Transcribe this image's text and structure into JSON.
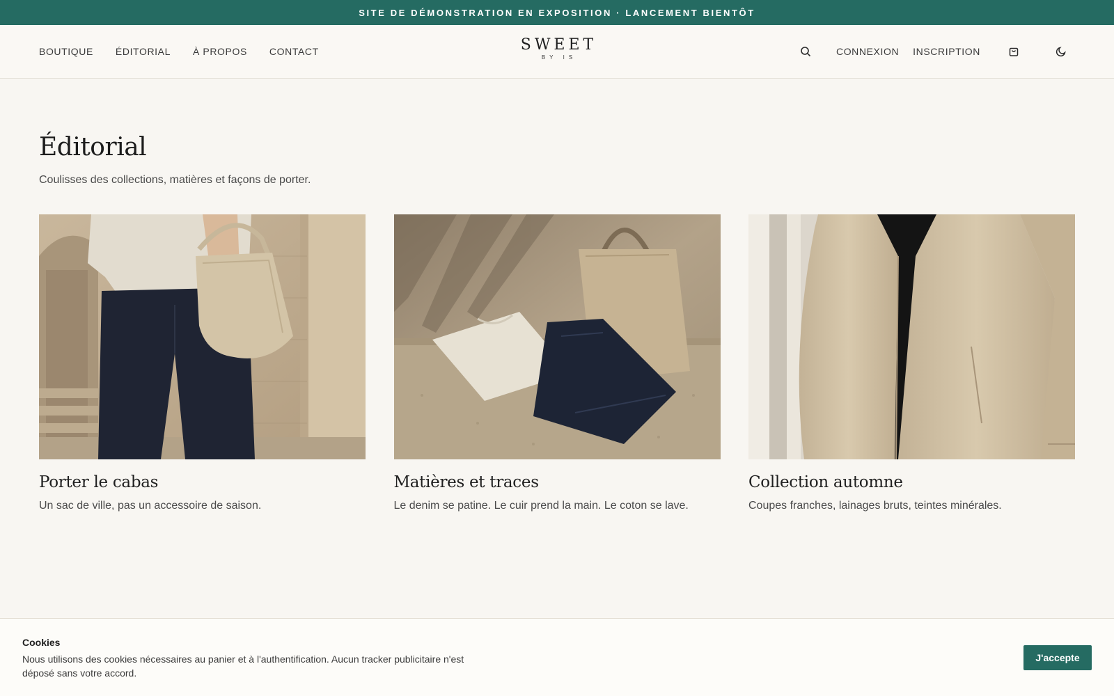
{
  "announcement": {
    "text": "SITE DE DÉMONSTRATION EN EXPOSITION · LANCEMENT BIENTÔT"
  },
  "header": {
    "nav_left": [
      {
        "label": "BOUTIQUE"
      },
      {
        "label": "ÉDITORIAL"
      },
      {
        "label": "À PROPOS"
      },
      {
        "label": "CONTACT"
      }
    ],
    "logo": {
      "main": "SWEET",
      "sub": "BY IS"
    },
    "nav_right": {
      "search_icon": "search-icon",
      "login": "CONNEXION",
      "signup": "INSCRIPTION",
      "cart_icon": "cart-icon",
      "theme_icon": "moon-icon"
    }
  },
  "main": {
    "title": "Éditorial",
    "subtitle": "Coulisses des collections, matières et façons de porter.",
    "articles": [
      {
        "title": "Porter le cabas",
        "excerpt": "Un sac de ville, pas un accessoire de saison."
      },
      {
        "title": "Matières et traces",
        "excerpt": "Le denim se patine. Le cuir prend la main. Le coton se lave."
      },
      {
        "title": "Collection automne",
        "excerpt": "Coupes franches, lainages bruts, teintes minérales."
      }
    ]
  },
  "cookie": {
    "title": "Cookies",
    "text": "Nous utilisons des cookies nécessaires au panier et à l'authentification. Aucun tracker publicitaire n'est déposé sans votre accord.",
    "accept_label": "J'accepte"
  },
  "colors": {
    "accent": "#256b62",
    "background": "#f8f6f2",
    "text": "#2a2a2a"
  }
}
